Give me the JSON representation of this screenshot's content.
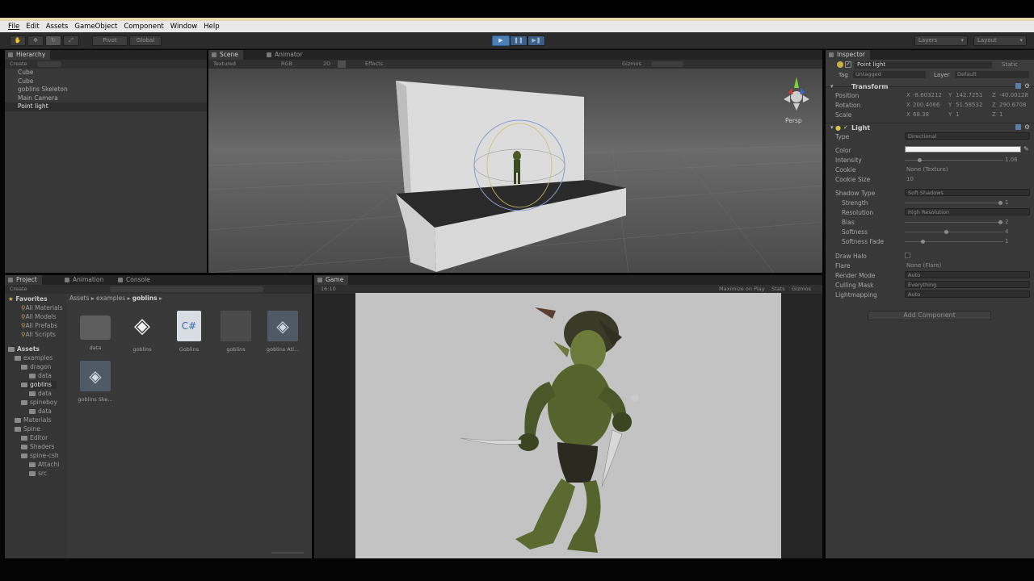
{
  "menu": [
    "File",
    "Edit",
    "Assets",
    "GameObject",
    "Component",
    "Window",
    "Help"
  ],
  "toolbar": {
    "pivot": "Pivot",
    "global": "Global",
    "layers": "Layers",
    "layout": "Layout"
  },
  "hierarchy": {
    "tab": "Hierarchy",
    "create": "Create",
    "items": [
      "Cube",
      "Cube",
      "goblins Skeleton",
      "Main Camera",
      "Point light"
    ]
  },
  "scene": {
    "tabs": [
      "Scene",
      "Animator"
    ],
    "shading": "Textured",
    "rgb": "RGB",
    "mode2d": "2D",
    "effects": "Effects",
    "gizmos": "Gizmos",
    "persp": "Persp"
  },
  "project": {
    "tabs": [
      "Project",
      "Animation",
      "Console"
    ],
    "create": "Create",
    "favorites": "Favorites",
    "fav_items": [
      "All Materials",
      "All Models",
      "All Prefabs",
      "All Scripts"
    ],
    "assets_root": "Assets",
    "tree": [
      "examples",
      "dragon",
      "data",
      "goblins",
      "data",
      "spineboy",
      "data",
      "Materials",
      "Spine",
      "Editor",
      "Shaders",
      "spine-csh",
      "Attachi",
      "src"
    ],
    "breadcrumb": [
      "Assets",
      "examples",
      "goblins"
    ],
    "files": [
      "data",
      "goblins",
      "Goblins",
      "goblins",
      "goblins Atl...",
      "goblins Ske..."
    ]
  },
  "game": {
    "tab": "Game",
    "aspect": "16:10",
    "maximize": "Maximize on Play",
    "stats": "Stats",
    "gizmos": "Gizmos"
  },
  "inspector": {
    "tab": "Inspector",
    "object_name": "Point light",
    "static": "Static",
    "tag_label": "Tag",
    "tag": "Untagged",
    "layer_label": "Layer",
    "layer": "Default",
    "transform": {
      "title": "Transform",
      "position": {
        "label": "Position",
        "x": "-8.603212",
        "y": "142.7251",
        "z": "-40.00128"
      },
      "rotation": {
        "label": "Rotation",
        "x": "200.4066",
        "y": "51.58532",
        "z": "290.6708"
      },
      "scale": {
        "label": "Scale",
        "x": "68.38",
        "y": "1",
        "z": "1"
      }
    },
    "light": {
      "title": "Light",
      "type_label": "Type",
      "type": "Directional",
      "color_label": "Color",
      "intensity_label": "Intensity",
      "intensity": "1.06",
      "cookie_label": "Cookie",
      "cookie": "None (Texture)",
      "cookie_size_label": "Cookie Size",
      "cookie_size": "10",
      "shadow_type_label": "Shadow Type",
      "shadow_type": "Soft Shadows",
      "strength_label": "Strength",
      "strength": "1",
      "resolution_label": "Resolution",
      "resolution": "High Resolution",
      "bias_label": "Bias",
      "bias": "2",
      "softness_label": "Softness",
      "softness": "4",
      "softness_fade_label": "Softness Fade",
      "softness_fade": "1",
      "draw_halo_label": "Draw Halo",
      "flare_label": "Flare",
      "flare": "None (Flare)",
      "render_mode_label": "Render Mode",
      "render_mode": "Auto",
      "culling_mask_label": "Culling Mask",
      "culling_mask": "Everything",
      "lightmapping_label": "Lightmapping",
      "lightmapping": "Auto"
    },
    "add_component": "Add Component"
  },
  "axis": {
    "x": "X",
    "y": "Y",
    "z": "Z"
  },
  "colors": {
    "menubar": "#e9e9e9",
    "accent": "#e8d9a6",
    "play_blue": "#4a7fb5"
  }
}
